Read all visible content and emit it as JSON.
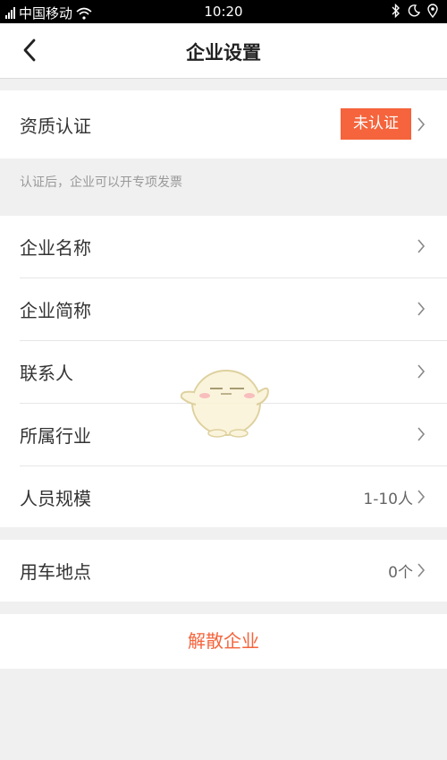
{
  "status_bar": {
    "carrier": "中国移动",
    "time": "10:20",
    "icons": [
      "signal-icon",
      "wifi-icon",
      "bluetooth-icon",
      "moon-icon",
      "location-icon"
    ]
  },
  "nav": {
    "title": "企业设置",
    "back_icon": "chevron-left-icon"
  },
  "qualification": {
    "label": "资质认证",
    "badge": "未认证",
    "note": "认证后，企业可以开专项发票"
  },
  "info_rows": [
    {
      "label": "企业名称",
      "value": ""
    },
    {
      "label": "企业简称",
      "value": ""
    },
    {
      "label": "联系人",
      "value": ""
    },
    {
      "label": "所属行业",
      "value": ""
    },
    {
      "label": "人员规模",
      "value": "1-10人"
    }
  ],
  "location_row": {
    "label": "用车地点",
    "value": "0个"
  },
  "dissolve_button": "解散企业",
  "colors": {
    "accent": "#f5643c",
    "background": "#f0f0f0",
    "text": "#333333",
    "muted": "#999999"
  }
}
